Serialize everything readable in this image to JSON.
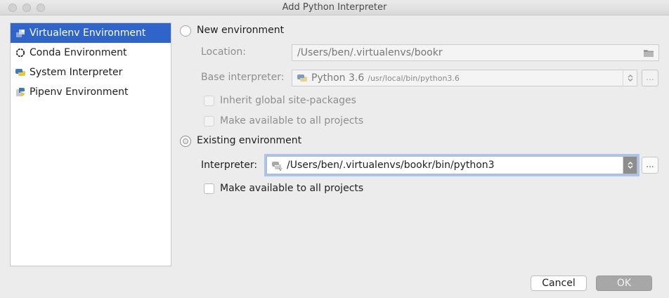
{
  "window": {
    "title": "Add Python Interpreter"
  },
  "sidebar": {
    "items": [
      {
        "label": "Virtualenv Environment",
        "icon": "virtualenv-icon",
        "selected": true
      },
      {
        "label": "Conda Environment",
        "icon": "conda-icon",
        "selected": false
      },
      {
        "label": "System Interpreter",
        "icon": "python-icon",
        "selected": false
      },
      {
        "label": "Pipenv Environment",
        "icon": "pipenv-icon",
        "selected": false
      }
    ]
  },
  "new_env": {
    "label": "New environment",
    "location_label": "Location:",
    "location_value": "/Users/ben/.virtualenvs/bookr",
    "base_label": "Base interpreter:",
    "base_name": "Python 3.6",
    "base_path": "/usr/local/bin/python3.6",
    "inherit_label": "Inherit global site-packages",
    "make_available_label": "Make available to all projects"
  },
  "existing_env": {
    "label": "Existing environment",
    "interpreter_label": "Interpreter:",
    "interpreter_value": "/Users/ben/.virtualenvs/bookr/bin/python3",
    "make_available_label": "Make available to all projects"
  },
  "buttons": {
    "browse": "...",
    "cancel": "Cancel",
    "ok": "OK"
  },
  "colors": {
    "selection": "#2f65ca",
    "focus_ring": "#a9c5ed"
  }
}
